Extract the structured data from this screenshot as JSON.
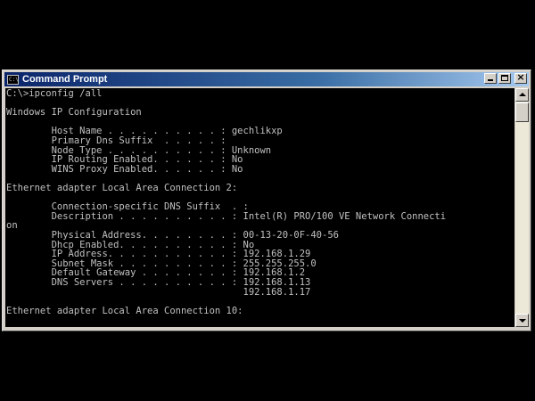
{
  "window": {
    "title": "Command Prompt",
    "icon": "console-icon",
    "icon_glyph": "C:\\",
    "buttons": [
      "minimize-icon",
      "maximize-icon",
      "close-icon"
    ],
    "close_glyph": "×"
  },
  "console": {
    "lines": [
      "C:\\>ipconfig /all",
      "",
      "Windows IP Configuration",
      "",
      "        Host Name . . . . . . . . . . : gechlikxp",
      "        Primary Dns Suffix  . . . . . :",
      "        Node Type . . . . . . . . . . : Unknown",
      "        IP Routing Enabled. . . . . . : No",
      "        WINS Proxy Enabled. . . . . . : No",
      "",
      "Ethernet adapter Local Area Connection 2:",
      "",
      "        Connection-specific DNS Suffix  . :",
      "        Description . . . . . . . . . . : Intel(R) PRO/100 VE Network Connecti",
      "on",
      "        Physical Address. . . . . . . . : 00-13-20-0F-40-56",
      "        Dhcp Enabled. . . . . . . . . . : No",
      "        IP Address. . . . . . . . . . . : 192.168.1.29",
      "        Subnet Mask . . . . . . . . . . : 255.255.255.0",
      "        Default Gateway . . . . . . . . : 192.168.1.2",
      "        DNS Servers . . . . . . . . . . : 192.168.1.13",
      "                                          192.168.1.17",
      "",
      "Ethernet adapter Local Area Connection 10:"
    ]
  },
  "colors": {
    "console_background": "#000000",
    "console_text": "#c0c0c0",
    "titlebar_start": "#0a246a",
    "titlebar_end": "#a6caf0"
  }
}
